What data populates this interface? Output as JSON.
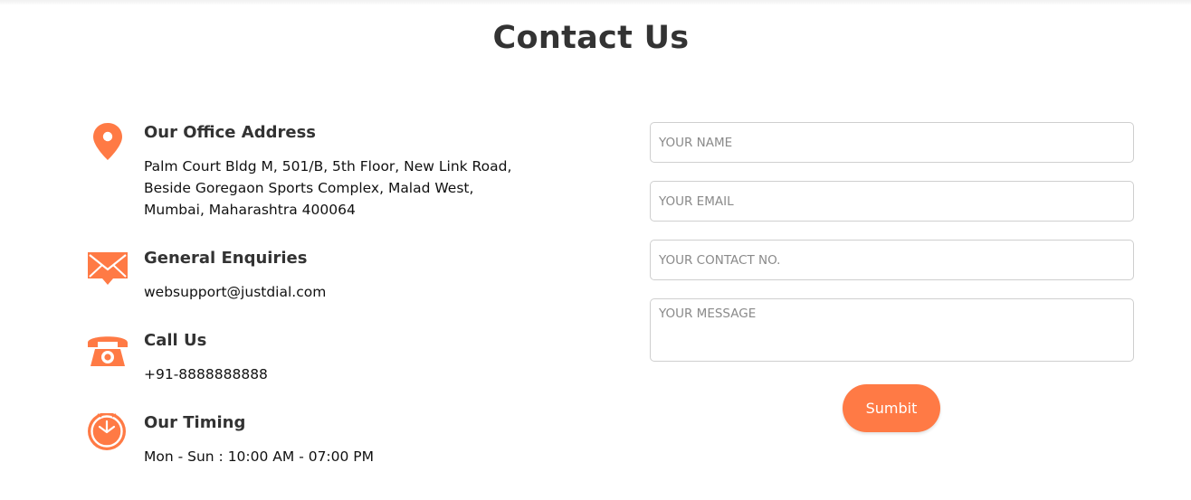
{
  "page": {
    "title": "Contact Us"
  },
  "colors": {
    "accent": "#ff7a45",
    "heading": "#333333",
    "border": "#cfcfcf"
  },
  "info": {
    "address": {
      "icon": "map-pin-icon",
      "heading": "Our Office Address",
      "lines": [
        "Palm Court Bldg M, 501/B, 5th Floor, New Link Road,",
        "Beside Goregaon Sports Complex, Malad West,",
        "Mumbai, Maharashtra 400064"
      ]
    },
    "enquiries": {
      "icon": "envelope-icon",
      "heading": "General Enquiries",
      "text": "websupport@justdial.com"
    },
    "call": {
      "icon": "telephone-icon",
      "heading": "Call Us",
      "text": "+91-8888888888"
    },
    "timing": {
      "icon": "clock-icon",
      "heading": "Our Timing",
      "text": "Mon - Sun : 10:00 AM - 07:00 PM"
    }
  },
  "form": {
    "name_placeholder": "YOUR NAME",
    "email_placeholder": "YOUR EMAIL",
    "contact_placeholder": "YOUR CONTACT NO.",
    "message_placeholder": "YOUR MESSAGE",
    "submit_label": "Sumbit"
  }
}
